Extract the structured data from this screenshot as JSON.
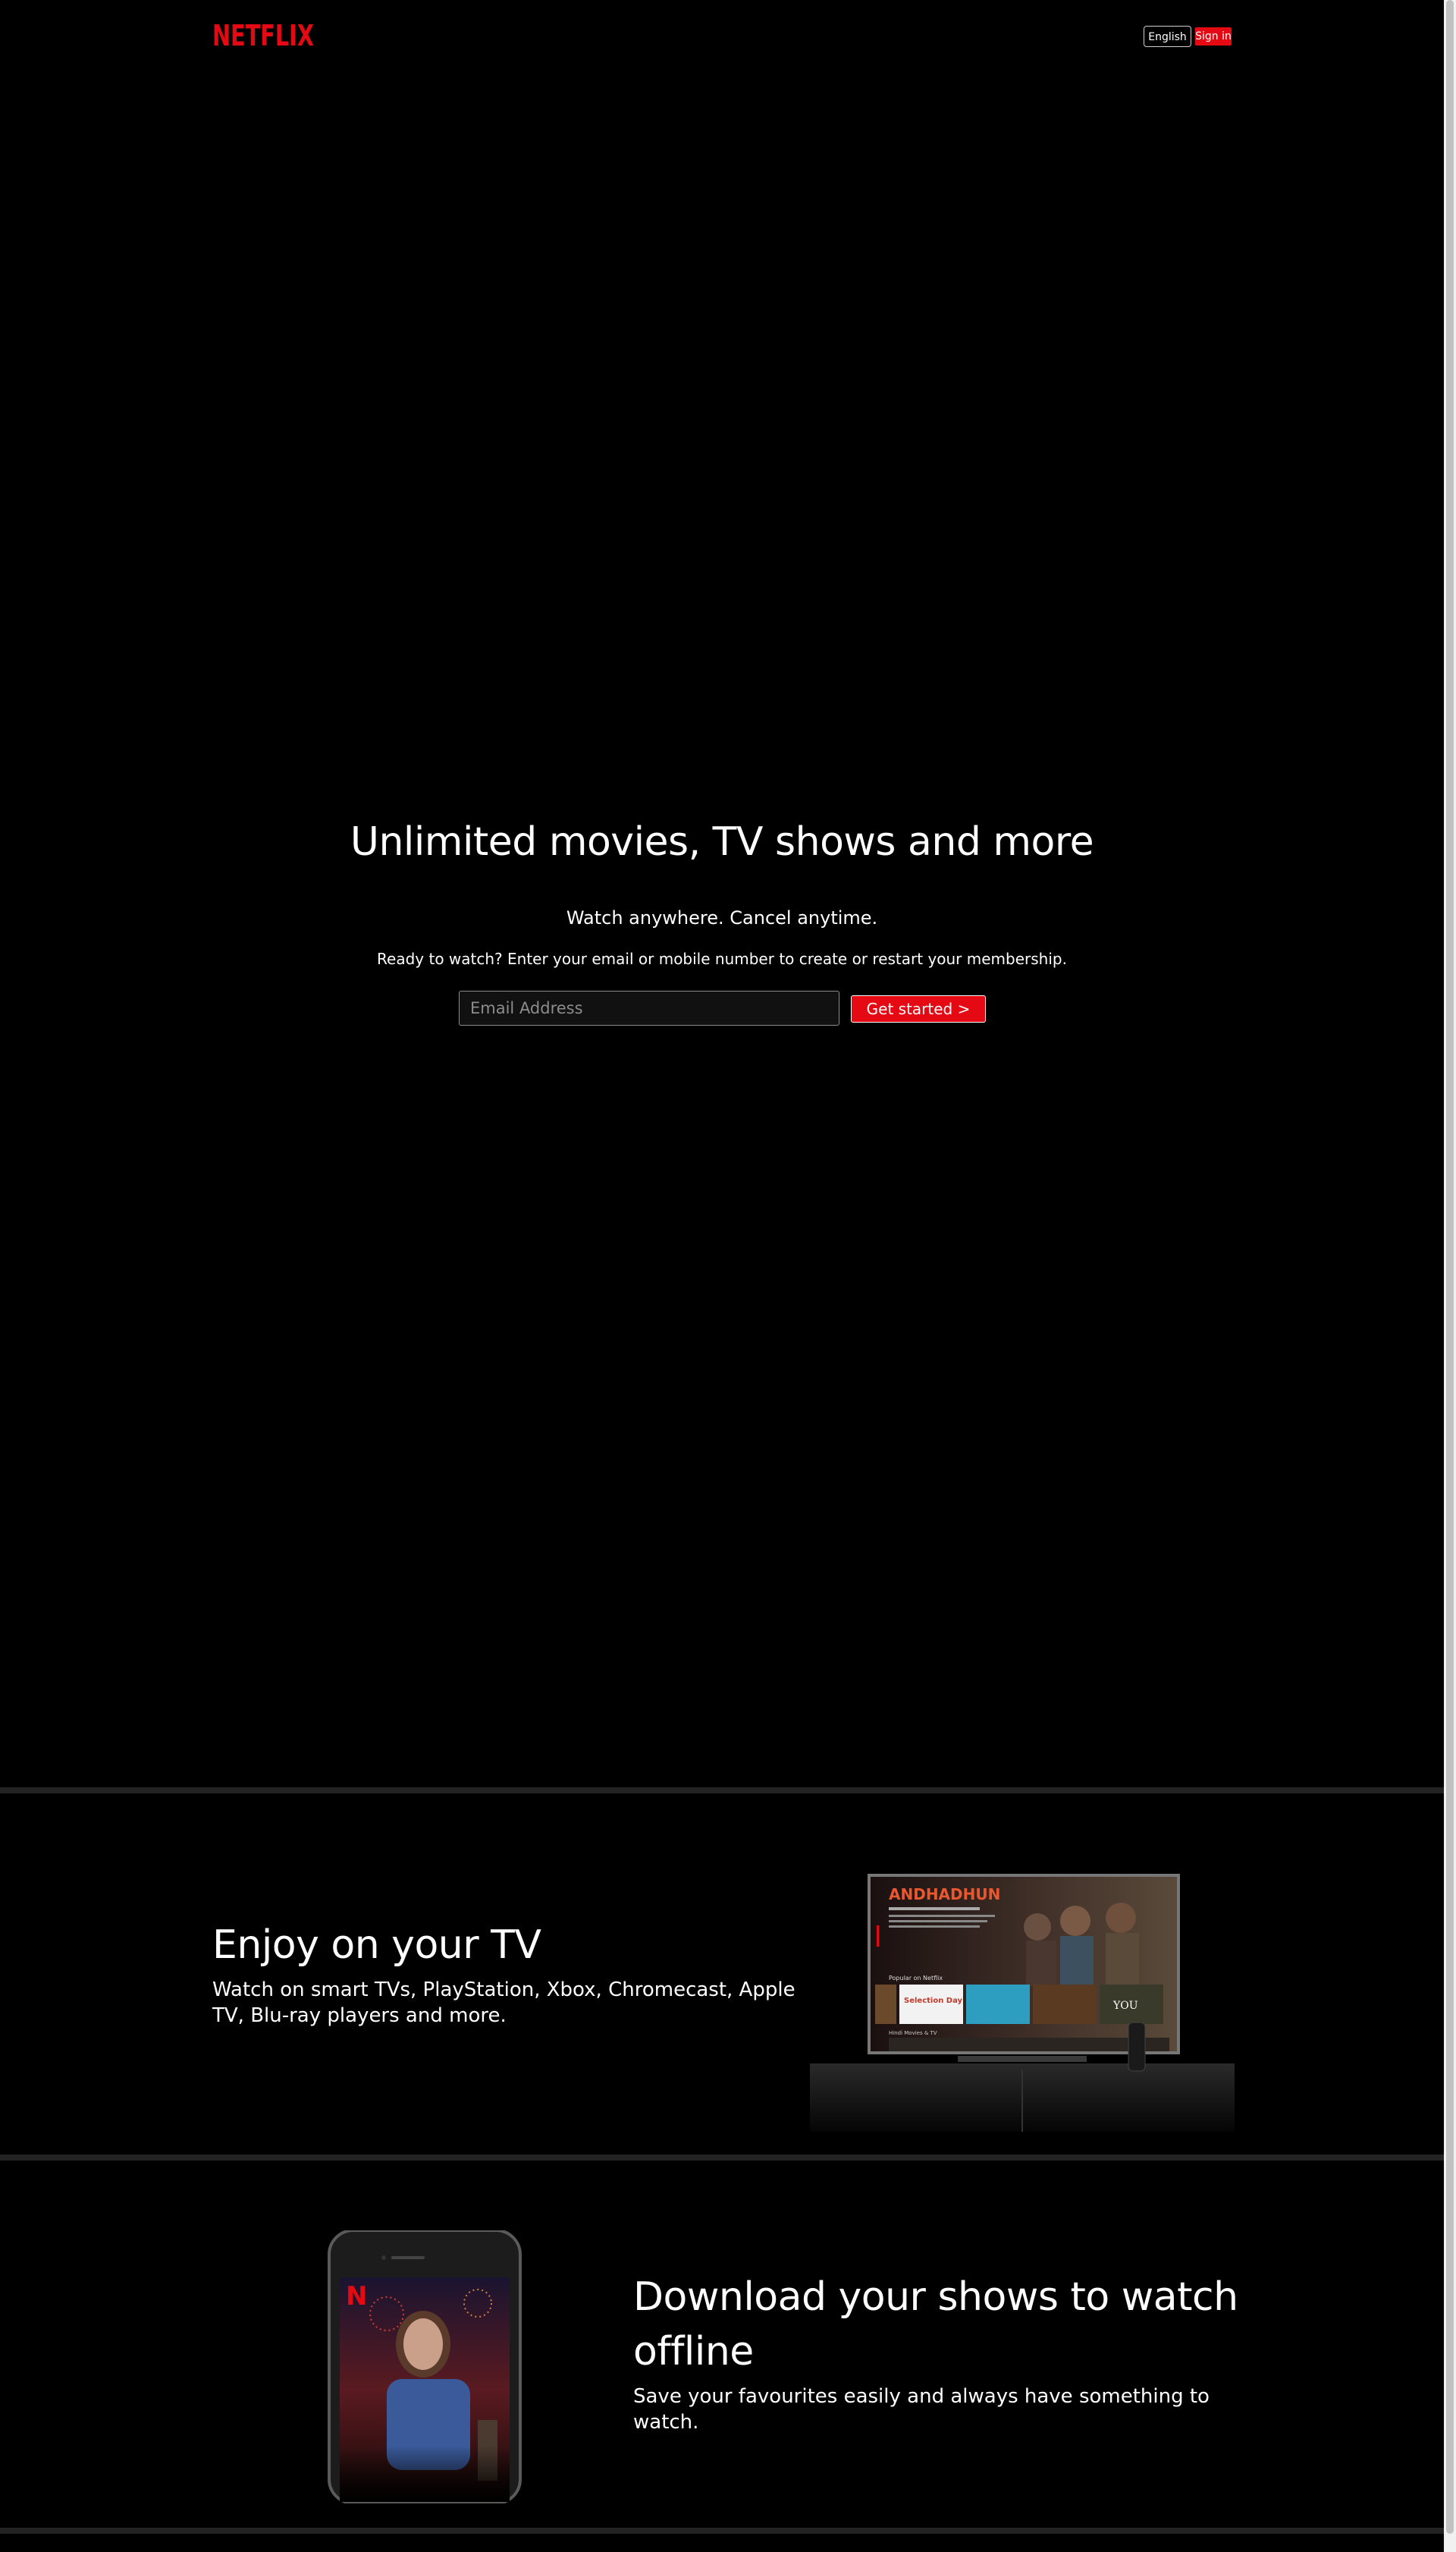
{
  "header": {
    "logo_text": "NETFLIX",
    "language": "English",
    "signin_label": "Sign in"
  },
  "hero": {
    "title": "Unlimited movies, TV shows and more",
    "subtitle": "Watch anywhere. Cancel anytime.",
    "cta_text": "Ready to watch? Enter your email or mobile number to create or restart your membership.",
    "email_placeholder": "Email Address",
    "get_started_label": "Get started >"
  },
  "tv_section": {
    "title": "Enjoy on your TV",
    "description": "Watch on smart TVs, PlayStation, Xbox, Chromecast, Apple TV, Blu-ray players and more.",
    "screen": {
      "movie_title": "ANDHADHUN",
      "row_label": "Popular on Netflix",
      "row2_label": "Hindi Movies & TV",
      "tile_labels": [
        "Selection Day",
        "YOU"
      ]
    }
  },
  "download_section": {
    "title": "Download your shows to watch offline",
    "description": "Save your favourites easily and always have something to watch."
  },
  "colors": {
    "brand_red": "#e50914",
    "background": "#000000",
    "divider": "#232323"
  }
}
